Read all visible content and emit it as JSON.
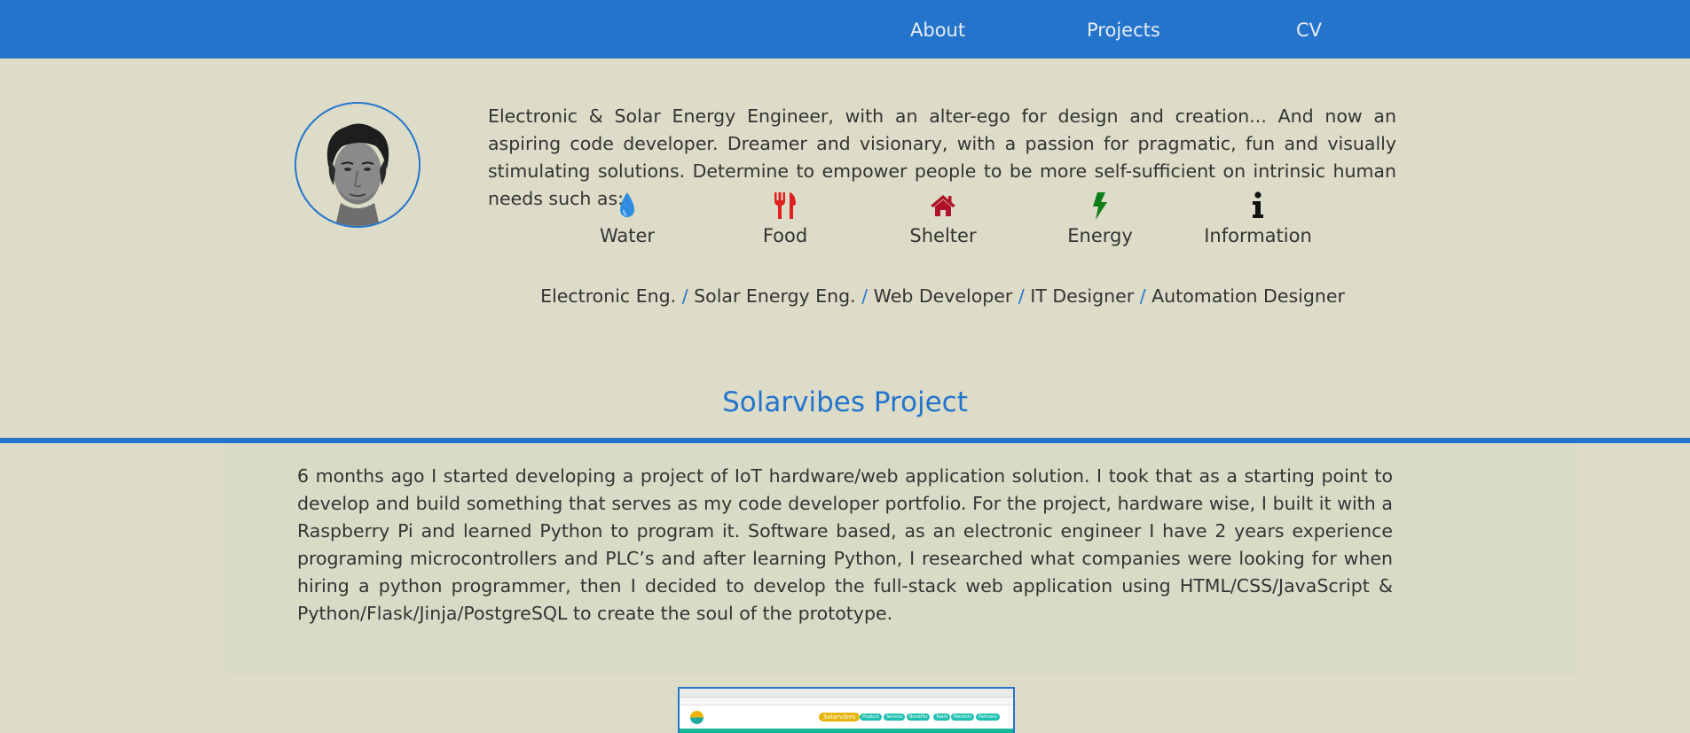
{
  "nav": {
    "about": "About",
    "projects": "Projects",
    "cv": "CV"
  },
  "profile": {
    "bio": "Electronic & Solar Energy Engineer, with an alter-ego for design and creation... And now an aspiring code developer. Dreamer and visionary, with a passion for pragmatic, fun and visually stimulating solutions. Determine to empower people to be more self-sufficient on intrinsic human needs such as:"
  },
  "needs": [
    {
      "label": "Water",
      "icon": "water-drop-icon",
      "color": "#2e8de0"
    },
    {
      "label": "Food",
      "icon": "fork-knife-icon",
      "color": "#e02020"
    },
    {
      "label": "Shelter",
      "icon": "house-icon",
      "color": "#b0122a"
    },
    {
      "label": "Energy",
      "icon": "lightning-bolt-icon",
      "color": "#0f7f1a"
    },
    {
      "label": "Information",
      "icon": "info-icon",
      "color": "#111111"
    }
  ],
  "roles": {
    "items": [
      "Electronic Eng.",
      "Solar Energy Eng.",
      "Web Developer",
      "IT Designer",
      "Automation Designer"
    ],
    "separator": "/"
  },
  "project": {
    "title": "Solarvibes Project",
    "description": "6 months ago I started developing a project of IoT hardware/web application solution. I took that as a starting point to develop and build something that serves as my code developer portfolio. For the project, hardware wise, I built it with a Raspberry Pi and learned Python to program it. Software based, as an electronic engineer I have 2 years experience programing microcontrollers and PLC’s and after learning Python, I researched what companies were looking for when hiring a python programmer, then I decided to develop the full-stack web application using HTML/CSS/JavaScript & Python/Flask/Jinja/PostgreSQL to create the soul of the prototype."
  },
  "thumbnail": {
    "brand": "Solarvibes",
    "menu": [
      "Product",
      "Service",
      "Benefits",
      "Team",
      "Mentors",
      "Partners"
    ]
  },
  "colors": {
    "accent": "#2474cc",
    "background": "#dcdcc8",
    "text": "#333333"
  }
}
